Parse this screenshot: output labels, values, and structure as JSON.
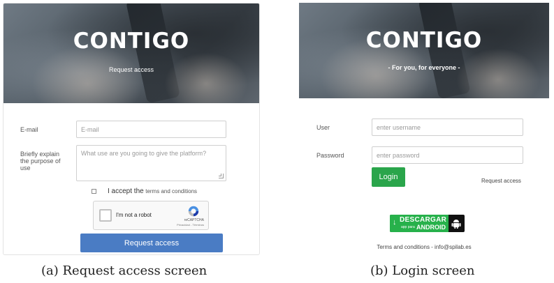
{
  "request_screen": {
    "brand": "CONTIGO",
    "subtitle": "Request access",
    "email_label": "E-mail",
    "email_placeholder": "E-mail",
    "purpose_label": "Briefly explain the purpose of use",
    "purpose_placeholder": "What use are you going to give the platform?",
    "accept_prefix": "I accept the",
    "accept_link": "terms and conditions",
    "captcha_text": "I'm not a robot",
    "captcha_brand": "reCAPTCHA",
    "captcha_links": "Privacidad - Términos",
    "submit_label": "Request access",
    "accent_color": "#4a7cc4"
  },
  "login_screen": {
    "brand": "CONTIGO",
    "tagline": "- For you, for everyone -",
    "user_label": "User",
    "user_placeholder": "enter username",
    "password_label": "Password",
    "password_placeholder": "enter password",
    "login_label": "Login",
    "request_access_link": "Request access",
    "badge_main": "DESCARGAR",
    "badge_small": "app para",
    "badge_platform": "ANDROID",
    "footer": "Terms and conditions - info@spilab.es",
    "accent_color": "#2aa54b"
  },
  "captions": {
    "a": "(a) Request access screen",
    "b": "(b) Login screen"
  }
}
